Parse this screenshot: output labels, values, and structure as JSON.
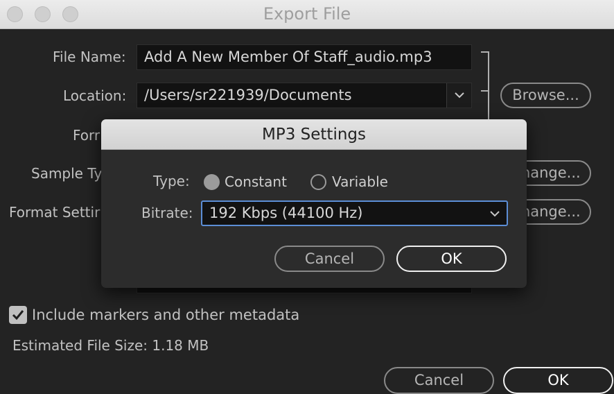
{
  "window": {
    "title": "Export File"
  },
  "form": {
    "file_name_label": "File Name:",
    "file_name_value": "Add A New Member Of Staff_audio.mp3",
    "location_label": "Location:",
    "location_value": "/Users/sr221939/Documents",
    "browse_label": "Browse...",
    "format_label_partial": "Forr",
    "sample_type_label_partial": "Sample Ty",
    "format_settings_label_partial": "Format Settir",
    "change_label_1": "Change...",
    "change_label_2": "Change...",
    "include_markers_label": "Include markers and other metadata",
    "include_markers_checked": true,
    "estimated_size_label": "Estimated File Size: 1.18 MB",
    "cancel_label": "Cancel",
    "ok_label": "OK"
  },
  "modal": {
    "title": "MP3 Settings",
    "type_label": "Type:",
    "type_options": [
      "Constant",
      "Variable"
    ],
    "type_selected": "Constant",
    "bitrate_label": "Bitrate:",
    "bitrate_value": "192 Kbps (44100 Hz)",
    "cancel_label": "Cancel",
    "ok_label": "OK"
  },
  "icons": {
    "dropdown": "chevron-down-icon",
    "check": "checkmark-icon"
  }
}
